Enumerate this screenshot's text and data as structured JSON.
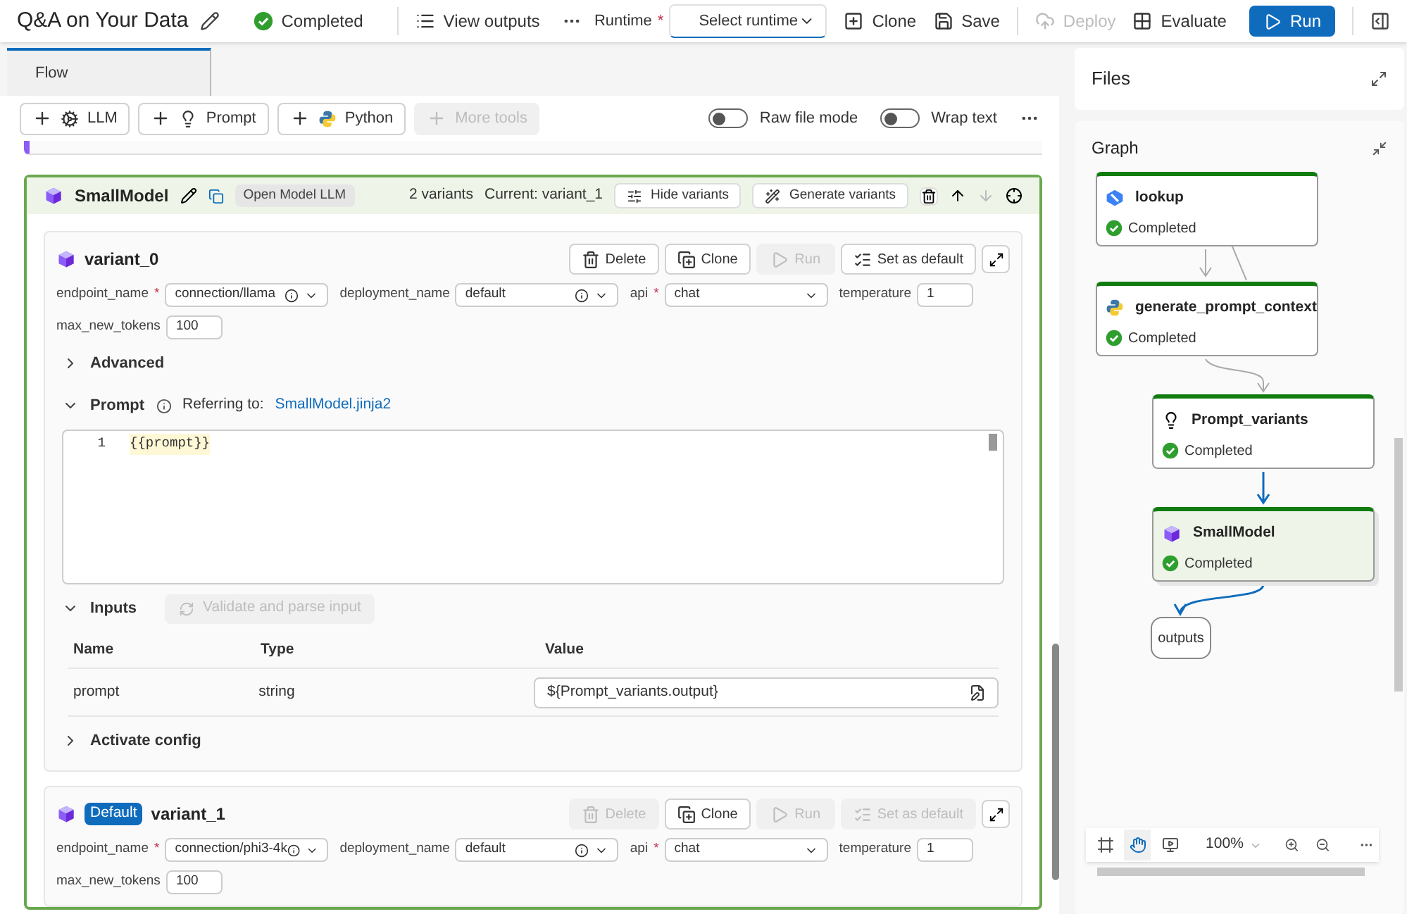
{
  "header": {
    "title": "Q&A on Your Data",
    "status": "Completed",
    "view_outputs": "View outputs",
    "runtime_label": "Runtime",
    "runtime_required_mark": "*",
    "runtime_select": {
      "placeholder": "Select runtime"
    },
    "actions": [
      {
        "label": "Clone",
        "kind": "clone",
        "disabled": false
      },
      {
        "label": "Save",
        "kind": "save",
        "disabled": false
      },
      {
        "label": "Deploy",
        "kind": "deploy",
        "disabled": true
      },
      {
        "label": "Evaluate",
        "kind": "evaluate",
        "disabled": false
      }
    ],
    "run": "Run"
  },
  "tabs": [
    {
      "label": "Flow",
      "selected": true
    }
  ],
  "toolbar": {
    "tools": [
      {
        "label": "LLM",
        "kind": "llm",
        "disabled": false
      },
      {
        "label": "Prompt",
        "kind": "prompt",
        "disabled": false
      },
      {
        "label": "Python",
        "kind": "python",
        "disabled": false
      },
      {
        "label": "More tools",
        "kind": "more",
        "disabled": true
      }
    ],
    "toggles": [
      {
        "label": "Raw file mode",
        "on": false
      },
      {
        "label": "Wrap text",
        "on": false
      }
    ]
  },
  "node": {
    "name": "SmallModel",
    "type_badge": "Open Model LLM",
    "variant_count": "2 variants",
    "current": "Current: variant_1",
    "buttons": [
      "Hide variants",
      "Generate variants"
    ],
    "variants": [
      {
        "name": "variant_0",
        "buttons": [
          {
            "label": "Delete",
            "kind": "delete",
            "disabled": false
          },
          {
            "label": "Clone",
            "kind": "clone",
            "disabled": false
          },
          {
            "label": "Run",
            "kind": "run",
            "disabled": true
          },
          {
            "label": "Set as default",
            "kind": "default",
            "disabled": false
          }
        ],
        "params": [
          {
            "label": "endpoint_name",
            "required_mark": "*",
            "value": "connection/llama",
            "kind": "select",
            "info": true
          },
          {
            "label": "deployment_name",
            "value": "default",
            "kind": "select",
            "info": true
          },
          {
            "label": "api",
            "required_mark": "*",
            "value": "chat",
            "kind": "select",
            "info": false
          },
          {
            "label": "temperature",
            "value": "1",
            "kind": "text"
          },
          {
            "label": "max_new_tokens",
            "value": "100",
            "kind": "text"
          }
        ],
        "sections": [
          {
            "kind": "advanced",
            "title": "Advanced",
            "expanded": false
          },
          {
            "kind": "prompt",
            "title": "Prompt",
            "expanded": true,
            "referring": "Referring to:",
            "link": "SmallModel.jinja2",
            "lines": [
              {
                "number": "1",
                "text": "{{prompt}}"
              }
            ]
          },
          {
            "kind": "inputs",
            "title": "Inputs",
            "expanded": true,
            "validate": {
              "label": "Validate and parse input",
              "disabled": true
            },
            "columns": [
              "Name",
              "Type",
              "Value"
            ],
            "rows": [
              {
                "name": "prompt",
                "type": "string",
                "value": "${Prompt_variants.output}"
              }
            ]
          },
          {
            "kind": "config",
            "title": "Activate config",
            "expanded": false
          }
        ]
      },
      {
        "name": "variant_1",
        "badge": "Default",
        "buttons": [
          {
            "label": "Delete",
            "kind": "delete",
            "disabled": true
          },
          {
            "label": "Clone",
            "kind": "clone",
            "disabled": false
          },
          {
            "label": "Run",
            "kind": "run",
            "disabled": true
          },
          {
            "label": "Set as default",
            "kind": "default",
            "disabled": true
          }
        ],
        "params": [
          {
            "label": "endpoint_name",
            "required_mark": "*",
            "value": "connection/phi3-4k",
            "kind": "select",
            "info": true
          },
          {
            "label": "deployment_name",
            "value": "default",
            "kind": "select",
            "info": true
          },
          {
            "label": "api",
            "required_mark": "*",
            "value": "chat",
            "kind": "select",
            "info": false
          },
          {
            "label": "temperature",
            "value": "1",
            "kind": "text"
          },
          {
            "label": "max_new_tokens",
            "value": "100",
            "kind": "text"
          }
        ]
      }
    ]
  },
  "files": {
    "title": "Files"
  },
  "graph": {
    "title": "Graph",
    "nodes": [
      {
        "name": "lookup",
        "kind": "lookup",
        "status": "Completed",
        "selected": false
      },
      {
        "name": "generate_prompt_context",
        "kind": "python",
        "status": "Completed",
        "selected": false
      },
      {
        "name": "Prompt_variants",
        "kind": "prompt",
        "status": "Completed",
        "selected": false
      },
      {
        "name": "SmallModel",
        "kind": "llm",
        "status": "Completed",
        "selected": true
      }
    ],
    "outputs": "outputs",
    "tools": [
      {
        "kind": "fit",
        "selected": false
      },
      {
        "kind": "pan",
        "selected": true
      },
      {
        "kind": "present",
        "selected": false
      }
    ],
    "zoom": "100%"
  }
}
